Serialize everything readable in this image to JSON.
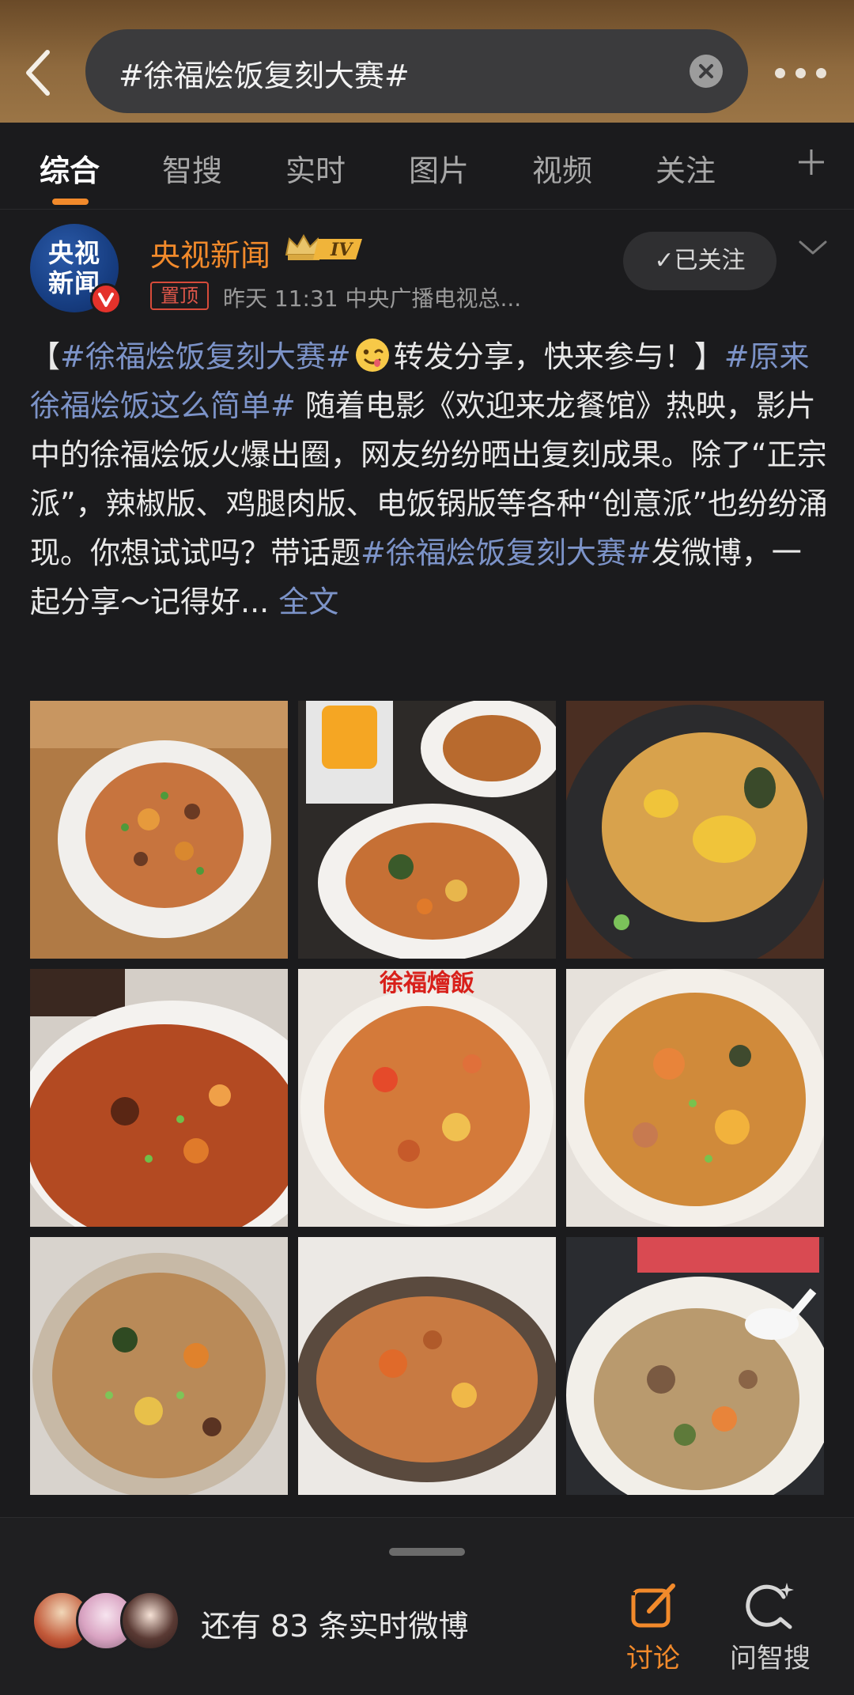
{
  "search": {
    "query": "#徐福烩饭复刻大赛#"
  },
  "tabs": [
    {
      "label": "综合",
      "active": true
    },
    {
      "label": "智搜"
    },
    {
      "label": "实时"
    },
    {
      "label": "图片"
    },
    {
      "label": "视频"
    },
    {
      "label": "关注"
    }
  ],
  "post": {
    "author": {
      "name": "央视新闻",
      "avatar_text": "央视新闻",
      "level_badge": "IV"
    },
    "pinned_label": "置顶",
    "meta": "昨天 11:31  中央广播电视总...",
    "follow_label": "✓已关注",
    "body": {
      "open_bracket": "【",
      "tag1": "#徐福烩饭复刻大赛#",
      "text1": "转发分享，快来参与！】",
      "tag2": "#原来徐福烩饭这么简单#",
      "text2": " 随着电影《欢迎来龙餐馆》热映，影片中的徐福烩饭火爆出圈，网友纷纷晒出复刻成果。除了“正宗派”，辣椒版、鸡腿肉版、电饭锅版等各种“创意派”也纷纷涌现。你想试试吗？带话题",
      "tag3": "#徐福烩饭复刻大赛#",
      "text3": "发微博，一起分享～记得好... ",
      "full_text_link": "全文"
    },
    "image_overlay_text": "徐福燴飯"
  },
  "bottom_bar": {
    "live_count_text": "还有 83 条实时微博",
    "discuss_label": "讨论",
    "ask_label": "问智搜"
  },
  "colors": {
    "accent": "#f28a2b",
    "hashtag": "#7c93c8",
    "background": "#1b1b1d"
  }
}
